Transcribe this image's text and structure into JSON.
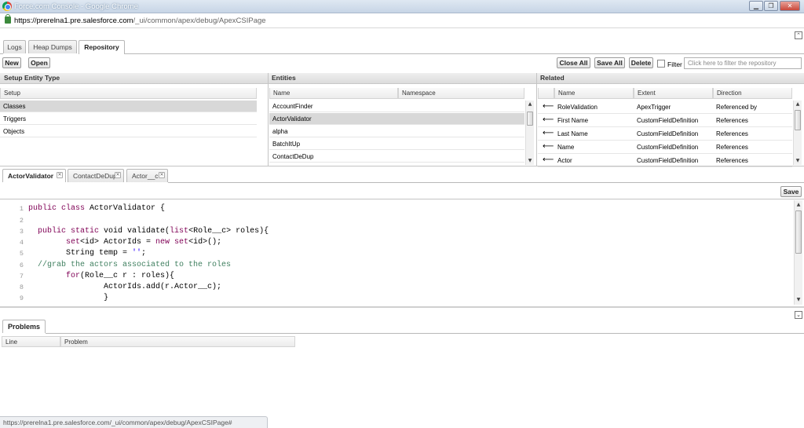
{
  "window": {
    "title": "Force.com Console - Google Chrome",
    "minimize": "▁",
    "maximize": "❐",
    "close": "✕"
  },
  "address": {
    "url_host": "https://prerelna1.pre.salesforce.com",
    "url_path": "/_ui/common/apex/debug/ApexCSIPage"
  },
  "top_toggle": "⌃",
  "tabs": [
    {
      "label": "Logs"
    },
    {
      "label": "Heap Dumps"
    },
    {
      "label": "Repository"
    }
  ],
  "toolbar": {
    "new_label": "New",
    "open_label": "Open",
    "close_all_label": "Close All",
    "save_all_label": "Save All",
    "delete_label": "Delete",
    "filter_label": "Filter",
    "filter_placeholder": "Click here to filter the repository"
  },
  "setup_panel": {
    "title": "Setup Entity Type",
    "column": "Setup",
    "rows": [
      "Classes",
      "Triggers",
      "Objects"
    ]
  },
  "entities_panel": {
    "title": "Entities",
    "columns": [
      "Name",
      "Namespace"
    ],
    "rows": [
      "AccountFinder",
      "ActorValidator",
      "alpha",
      "BatchItUp",
      "ContactDeDup"
    ]
  },
  "related_panel": {
    "title": "Related",
    "columns": [
      "Name",
      "Extent",
      "Direction"
    ],
    "arrow": "⟵",
    "rows": [
      {
        "name": "RoleValidation",
        "extent": "ApexTrigger",
        "direction": "Referenced by"
      },
      {
        "name": "First Name",
        "extent": "CustomFieldDefinition",
        "direction": "References"
      },
      {
        "name": "Last Name",
        "extent": "CustomFieldDefinition",
        "direction": "References"
      },
      {
        "name": "Name",
        "extent": "CustomFieldDefinition",
        "direction": "References"
      },
      {
        "name": "Actor",
        "extent": "CustomFieldDefinition",
        "direction": "References"
      }
    ]
  },
  "editor_tabs": [
    {
      "label": "ActorValidator"
    },
    {
      "label": "ContactDeDup"
    },
    {
      "label": "Actor__c"
    }
  ],
  "editor_close_glyph": "✕",
  "editor": {
    "save_label": "Save",
    "line_numbers": [
      "1",
      "2",
      "3",
      "4",
      "5",
      "6",
      "7",
      "8",
      "9"
    ]
  },
  "problems": {
    "tab_label": "Problems",
    "columns": [
      "Line",
      "Problem"
    ],
    "toggle": "⌄"
  },
  "status_url": "https://prerelna1.pre.salesforce.com/_ui/common/apex/debug/ApexCSIPage#",
  "colors": {
    "keyword": "#7f0055",
    "comment": "#3f7f5f",
    "string": "#2a00ff",
    "selection": "#d8d8d8"
  }
}
